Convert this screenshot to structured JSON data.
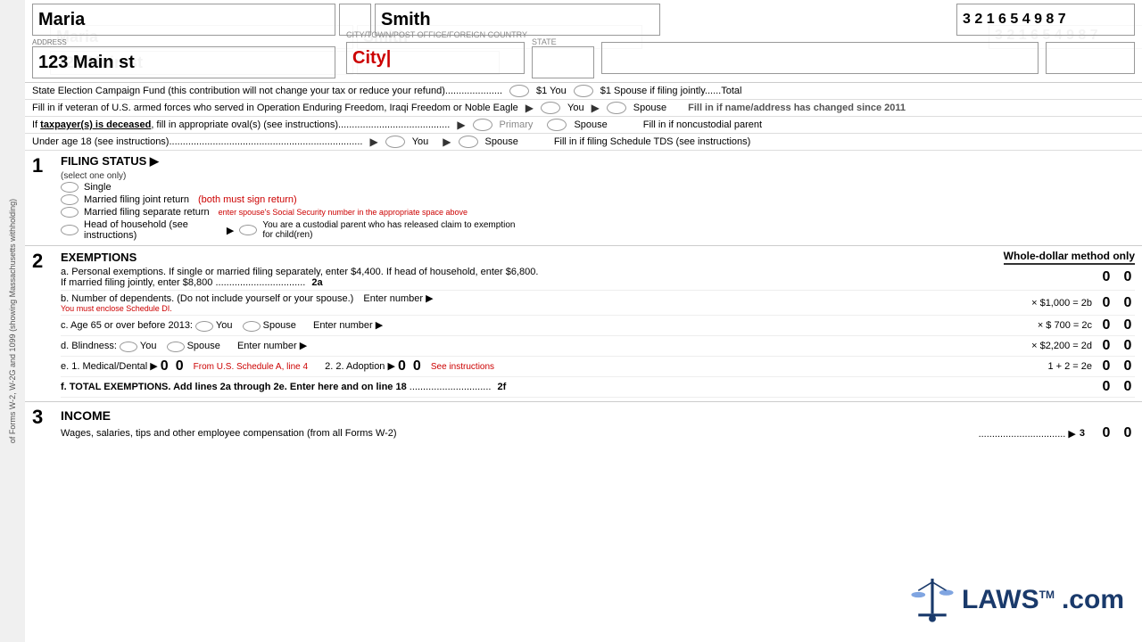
{
  "side_text": "of Forms W-2, W-2G and 1099 (showing Massachusetts withholding)",
  "header": {
    "first_name": "Maria",
    "last_name": "Smith",
    "ssn": "3 2 1 6 5 4 9 8 7",
    "address": "123 Main st",
    "city": "City",
    "city_label": "CITY/TOWN/POST OFFICE/FOREIGN COUNTRY",
    "state_label": "STATE",
    "address_label": "ADDRESS"
  },
  "campaign_fund": {
    "text": "State Election Campaign Fund (this contribution will not change your tax or reduce your refund).....................",
    "you_label": "$1 You",
    "spouse_label": "$1 Spouse if filing jointly......Total"
  },
  "veteran_row": {
    "text": "Fill in if veteran of U.S. armed forces who served in Operation Enduring Freedom, Iraqi Freedom or Noble Eagle",
    "you_label": "You",
    "spouse_label": "Spouse"
  },
  "deceased_row": {
    "text": "If taxpayer(s) is deceased, fill in appropriate oval(s) (see instructions).......................................",
    "primary_label": "Primary",
    "spouse_label": "Spouse"
  },
  "under18_row": {
    "text": "Under age 18 (see instructions).......................................................................",
    "you_label": "You",
    "spouse_label": "Spouse"
  },
  "right_options": {
    "name_changed": "Fill in if name/address has changed since 2011",
    "noncustodial": "Fill in if noncustodial parent",
    "schedule_tds": "Fill in if filing Schedule TDS (see instructions)"
  },
  "section1": {
    "num": "1",
    "title": "FILING STATUS",
    "subtitle": "(select one only)",
    "single": "Single",
    "married_joint": "Married filing joint return",
    "married_joint_note": "(both must sign return)",
    "married_separate": "Married filing separate return",
    "married_separate_note": "enter spouse's Social Security number in the appropriate space above",
    "head_household": "Head of household (see instructions)",
    "head_household_note": "You are a custodial parent who has released claim to exemption for child(ren)"
  },
  "section2": {
    "num": "2",
    "title": "EXEMPTIONS",
    "whole_dollar": "Whole-dollar method only",
    "row_a": {
      "label": "a. Personal exemptions. If single or married filing separately, enter $4,400. If head of household, enter $6,800.",
      "label2": "If married filing jointly, enter $8,800",
      "line_ref": "2a",
      "values": [
        "0",
        "0"
      ]
    },
    "row_b": {
      "label": "b. Number of dependents. (Do not include yourself or your spouse.)",
      "note": "You must enclose Schedule DI.",
      "enter_number": "Enter number",
      "multiplier": "× $1,000 = 2b",
      "values": [
        "0",
        "0"
      ]
    },
    "row_c": {
      "label": "c. Age 65 or over before 2013:",
      "you_label": "You",
      "spouse_label": "Spouse",
      "enter_number": "Enter number",
      "multiplier": "× $  700 = 2c",
      "values": [
        "0",
        "0"
      ]
    },
    "row_d": {
      "label": "d. Blindness:",
      "you_label": "You",
      "spouse_label": "Spouse",
      "enter_number": "Enter number",
      "multiplier": "× $2,200 = 2d",
      "values": [
        "0",
        "0"
      ]
    },
    "row_e": {
      "label": "e. 1. Medical/\nDental",
      "from_label": "From U.S. Schedule A, line 4",
      "adoption_label": "2. Adoption",
      "see_instructions": "See instructions",
      "formula": "1 + 2 = 2e",
      "val1": "0",
      "val2": "0",
      "val3": "0",
      "val4": "0",
      "values": [
        "0",
        "0"
      ]
    },
    "row_f": {
      "label": "f. TOTAL EXEMPTIONS. Add lines 2a through 2e. Enter here and on line 18",
      "dots": "..............................",
      "line_ref": "2f",
      "values": [
        "0",
        "0"
      ]
    }
  },
  "section3": {
    "num": "3",
    "title": "INCOME",
    "wages_label": "Wages, salaries, tips and other employee compensation (from all Forms W-2)",
    "wages_ref": "3",
    "values": [
      "0",
      "0"
    ]
  },
  "laws_watermark": {
    "text": "LAWS",
    "tm": "TM",
    "dotcom": ".com"
  }
}
